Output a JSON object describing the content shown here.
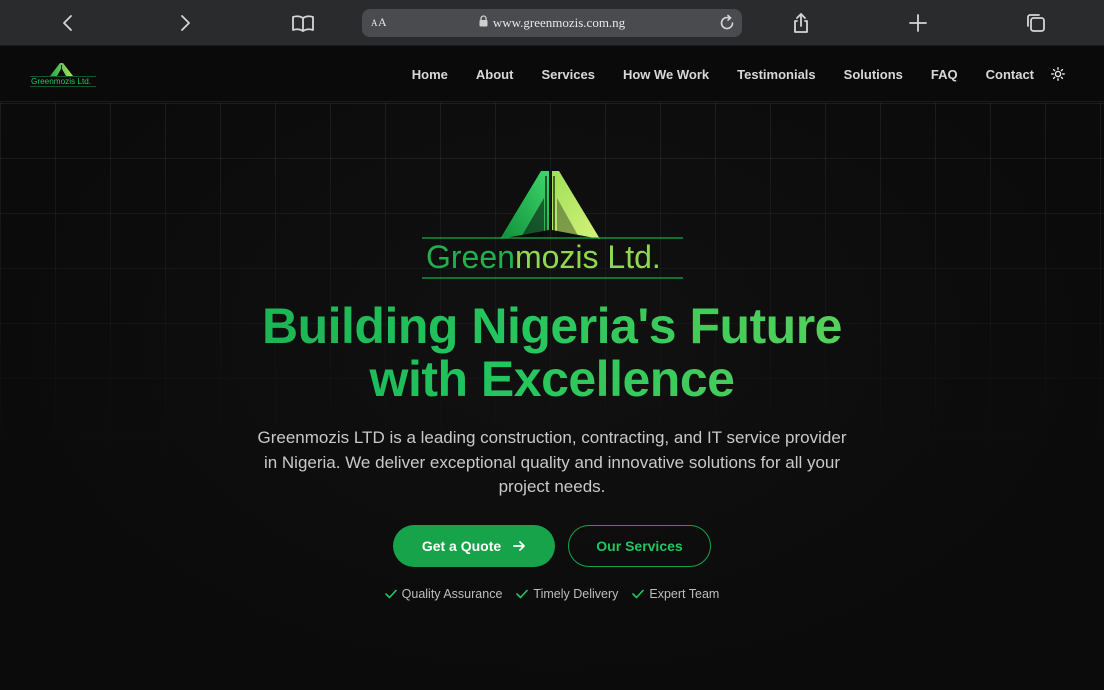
{
  "browser": {
    "text_size_label": "AA",
    "url": "www.greenmozis.com.ng"
  },
  "nav": {
    "logo_text": "Greenmozis Ltd.",
    "links": [
      "Home",
      "About",
      "Services",
      "How We Work",
      "Testimonials",
      "Solutions",
      "FAQ",
      "Contact"
    ]
  },
  "hero": {
    "logo_text_green": "Green",
    "logo_text_rest": "mozis Ltd.",
    "title_line1": "Building Nigeria's Future",
    "title_line2": "with Excellence",
    "description": "Greenmozis LTD is a leading construction, contracting, and IT service provider in Nigeria. We deliver exceptional quality and innovative solutions for all your project needs.",
    "primary_button": "Get a Quote",
    "secondary_button": "Our Services",
    "features": [
      "Quality Assurance",
      "Timely Delivery",
      "Expert Team"
    ]
  },
  "colors": {
    "brand_green": "#16a34a",
    "accent_light_green": "#7ed957",
    "background": "#0b0b0b"
  },
  "icons": {
    "back": "chevron-left-icon",
    "forward": "chevron-right-icon",
    "bookmarks": "book-icon",
    "lock": "lock-icon",
    "reload": "reload-icon",
    "share": "share-icon",
    "new_tab": "plus-icon",
    "tabs": "tabs-icon",
    "theme": "sun-icon",
    "arrow": "arrow-right-icon",
    "check": "check-icon"
  }
}
